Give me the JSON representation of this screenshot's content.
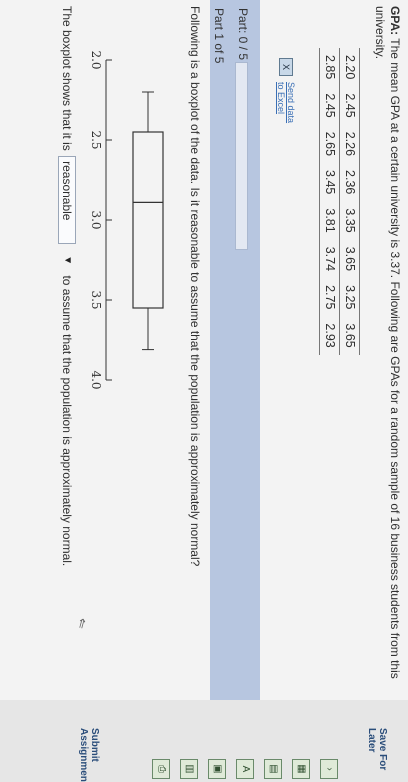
{
  "question": {
    "label": "GPA:",
    "text": "The mean GPA at a certain university is 3.37. Following are GPAs for a random sample of 16 business students from this university."
  },
  "gpa_rows": [
    [
      "2.20",
      "2.45",
      "2.26",
      "2.36",
      "3.35",
      "3.65",
      "3.25",
      "3.65"
    ],
    [
      "2.85",
      "2.45",
      "2.65",
      "3.45",
      "3.81",
      "3.74",
      "2.75",
      "2.93"
    ]
  ],
  "excel_link": {
    "line1": "Send data",
    "line2": "to Excel"
  },
  "part": {
    "label": "Part: 0 / 5",
    "sub_label": "Part 1 of 5",
    "progress": 0
  },
  "prompt": "Following is a boxplot of the data. Is it reasonable to assume that the population is approximately normal?",
  "chart_data": {
    "type": "boxplot",
    "xlim": [
      2.0,
      4.0
    ],
    "ticks": [
      2.0,
      2.5,
      3.0,
      3.5,
      4.0
    ],
    "tick_labels": [
      "2.0",
      "2.5",
      "3.0",
      "3.5",
      "4.0"
    ],
    "min": 2.2,
    "q1": 2.45,
    "median": 2.89,
    "q3": 3.55,
    "max": 3.81
  },
  "answer": {
    "before": "The boxplot shows that it is",
    "selected": "reasonable",
    "after": "to assume that the population is approximately normal."
  },
  "footer": {
    "save": "Save For Later",
    "submit": "Submit Assignment"
  },
  "side_icons": [
    "chevron-icon",
    "grid-icon",
    "table-icon",
    "spell-icon",
    "calculator-icon",
    "chart-icon",
    "print-icon"
  ]
}
